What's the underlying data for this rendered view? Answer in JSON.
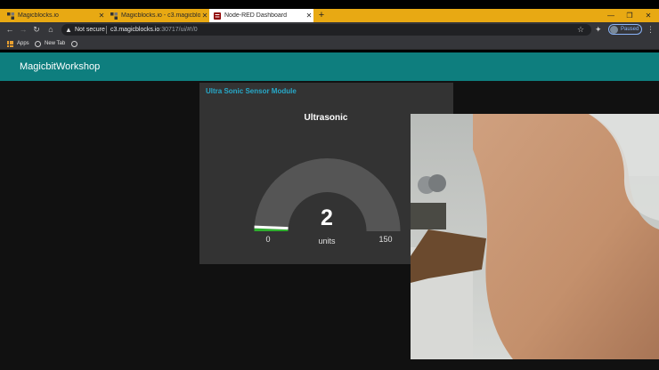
{
  "browser": {
    "tabs": [
      {
        "label": "Magicblocks.io",
        "active": false
      },
      {
        "label": "Magicblocks.io - c3.magicblocks.io",
        "active": false
      },
      {
        "label": "Node-RED Dashboard",
        "active": true
      }
    ],
    "new_tab_symbol": "+",
    "address": {
      "security_label": "Not secure",
      "host": "c3.magicblocks.io",
      "path": ":30717/ui/#!/0"
    },
    "profile_label": "Paused",
    "bookmarks": [
      {
        "label": "Apps",
        "icon": "apps-grid-icon"
      },
      {
        "label": "New Tab",
        "icon": "globe-icon"
      }
    ]
  },
  "dashboard": {
    "title": "MagicbitWorkshop",
    "header_color": "#0e7e7e",
    "card": {
      "title": "Ultra Sonic Sensor Module",
      "title_color": "#27a9c9",
      "gauge": {
        "label": "Ultrasonic",
        "value": "2",
        "value_num": 2,
        "units": "units",
        "min": "0",
        "max": "150",
        "min_num": 0,
        "max_num": 150,
        "fill_color": "#2fae2f",
        "track_color": "#555555"
      }
    }
  }
}
